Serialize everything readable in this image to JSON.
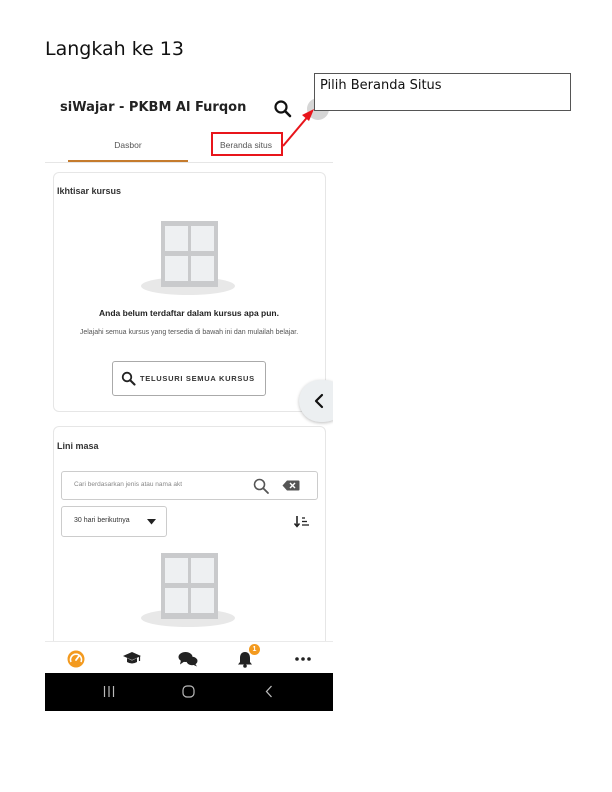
{
  "step_title": "Langkah ke 13",
  "callout": {
    "text": "Pilih Beranda Situs"
  },
  "header": {
    "title": "siWajar - PKBM Al Furqon"
  },
  "tabs": [
    {
      "label": "Dasbor"
    },
    {
      "label": "Beranda situs"
    }
  ],
  "course_overview": {
    "title": "Ikhtisar kursus",
    "empty_title": "Anda belum terdaftar dalam kursus apa pun.",
    "empty_subtitle": "Jelajahi semua kursus yang tersedia di bawah ini dan mulailah belajar.",
    "browse_button": "TELUSURI SEMUA KURSUS"
  },
  "timeline": {
    "title": "Lini masa",
    "search_placeholder": "Cari berdasarkan jenis atau nama akt",
    "filter_value": "30 hari berikutnya"
  },
  "bottom_nav": {
    "notification_count": "1"
  },
  "colors": {
    "accent": "#c57b2d",
    "highlight_red": "#e8151b",
    "nav_orange": "#f39a1f"
  }
}
